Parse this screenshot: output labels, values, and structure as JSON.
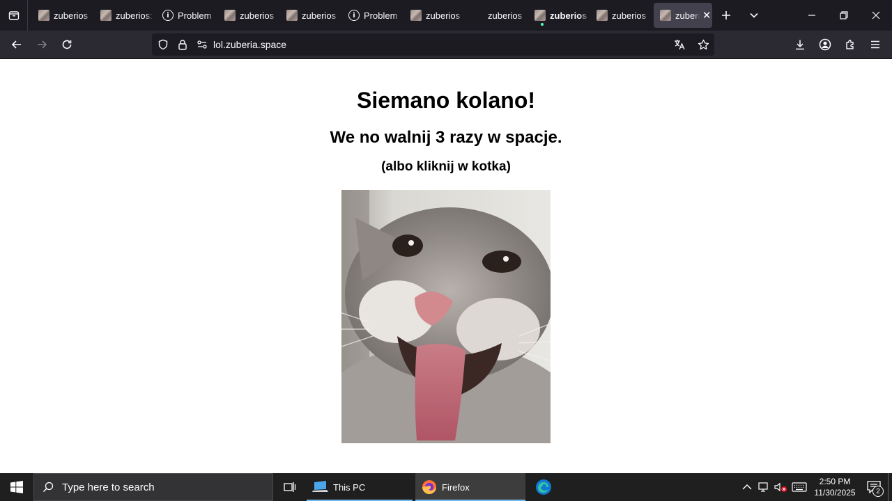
{
  "browser": {
    "tabs": [
      {
        "label": "zuberios",
        "favicon": "cat-favicon",
        "bold": false
      },
      {
        "label": "zuberios:",
        "favicon": "cat-favicon",
        "bold": false
      },
      {
        "label": "Problem",
        "favicon": "info-icon",
        "bold": false
      },
      {
        "label": "zuberios",
        "favicon": "cat-favicon",
        "bold": false
      },
      {
        "label": "zuberios",
        "favicon": "cat-favicon",
        "bold": false
      },
      {
        "label": "Problem",
        "favicon": "info-icon",
        "bold": false
      },
      {
        "label": "zuberios",
        "favicon": "cat-favicon",
        "bold": false
      },
      {
        "label": "zuberios",
        "favicon": "none",
        "bold": false
      },
      {
        "label": "zuberios",
        "favicon": "cat-favicon",
        "bold": true,
        "playing_dot": true
      },
      {
        "label": "zuberios",
        "favicon": "cat-favicon",
        "bold": false
      },
      {
        "label": "zuberi",
        "favicon": "cat-favicon",
        "bold": false,
        "active": true
      }
    ],
    "url": "lol.zuberia.space"
  },
  "page": {
    "h1": "Siemano kolano!",
    "h2": "We no walnij 3 razy w spacje.",
    "h3": "(albo kliknij w kotka)",
    "image_alt": "cat"
  },
  "taskbar": {
    "search_placeholder": "Type here to search",
    "apps": [
      {
        "label": "This PC",
        "icon": "this-pc-icon",
        "active": false
      },
      {
        "label": "Firefox",
        "icon": "firefox-icon",
        "active": true
      }
    ],
    "time": "2:50 PM",
    "date": "11/30/2025",
    "notification_count": "2"
  },
  "colors": {
    "tabstrip_bg": "#1c1b22",
    "navbar_bg": "#2b2a33",
    "active_tab_bg": "#42414d",
    "taskbar_bg": "#1f1f1f",
    "taskbar_accent": "#76b9ed"
  }
}
